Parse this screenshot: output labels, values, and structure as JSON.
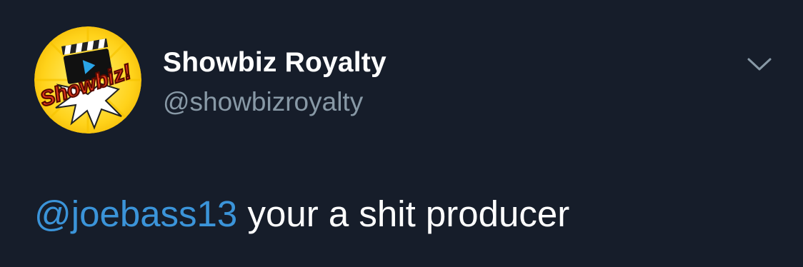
{
  "tweet": {
    "user": {
      "display_name": "Showbiz Royalty",
      "handle": "@showbizroyalty",
      "avatar_text": "Showbiz!",
      "avatar_icon": "showbiz-logo-avatar"
    },
    "menu_icon": "chevron-down-icon",
    "body": {
      "mention": "@joebass13",
      "text": " your a shit producer"
    }
  },
  "colors": {
    "background": "#161d2a",
    "name": "#ffffff",
    "handle": "#8899a6",
    "mention": "#3b94d9",
    "body_text": "#ffffff",
    "chevron": "#8899a6"
  }
}
